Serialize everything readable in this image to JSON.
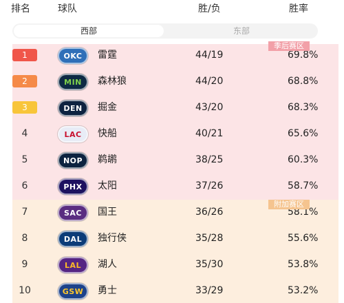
{
  "header": {
    "rank": "排名",
    "team": "球队",
    "wl": "胜/负",
    "pct": "胜率"
  },
  "tabs": {
    "west": "西部",
    "east": "东部"
  },
  "zones": {
    "playoff": "季后赛区",
    "playin": "附加赛区"
  },
  "rank_colors": {
    "1": "#f0564a",
    "2": "#f58a48",
    "3": "#f8c53a"
  },
  "teams": [
    {
      "rank": "1",
      "logo": "OKC",
      "name": "雷霆",
      "wl": "44/19",
      "pct": "69.8%",
      "logo_bg": "#2f6fb8",
      "logo_fg": "#ffffff"
    },
    {
      "rank": "2",
      "logo": "MIN",
      "name": "森林狼",
      "wl": "44/20",
      "pct": "68.8%",
      "logo_bg": "#0e2a44",
      "logo_fg": "#7fd14b"
    },
    {
      "rank": "3",
      "logo": "DEN",
      "name": "掘金",
      "wl": "43/20",
      "pct": "68.3%",
      "logo_bg": "#0d2240",
      "logo_fg": "#ffffff"
    },
    {
      "rank": "4",
      "logo": "LAC",
      "name": "快船",
      "wl": "40/21",
      "pct": "65.6%",
      "logo_bg": "#e8ecf6",
      "logo_fg": "#c8102e"
    },
    {
      "rank": "5",
      "logo": "NOP",
      "name": "鹈鹕",
      "wl": "38/25",
      "pct": "60.3%",
      "logo_bg": "#0c2340",
      "logo_fg": "#ffffff"
    },
    {
      "rank": "6",
      "logo": "PHX",
      "name": "太阳",
      "wl": "37/26",
      "pct": "58.7%",
      "logo_bg": "#1d1160",
      "logo_fg": "#ffffff"
    },
    {
      "rank": "7",
      "logo": "SAC",
      "name": "国王",
      "wl": "36/26",
      "pct": "58.1%",
      "logo_bg": "#5a2d81",
      "logo_fg": "#ffffff"
    },
    {
      "rank": "8",
      "logo": "DAL",
      "name": "独行侠",
      "wl": "35/28",
      "pct": "55.6%",
      "logo_bg": "#0c3c78",
      "logo_fg": "#ffffff"
    },
    {
      "rank": "9",
      "logo": "LAL",
      "name": "湖人",
      "wl": "35/30",
      "pct": "53.8%",
      "logo_bg": "#552583",
      "logo_fg": "#fdb927"
    },
    {
      "rank": "10",
      "logo": "GSW",
      "name": "勇士",
      "wl": "33/29",
      "pct": "53.2%",
      "logo_bg": "#1d428a",
      "logo_fg": "#ffc72c"
    }
  ]
}
